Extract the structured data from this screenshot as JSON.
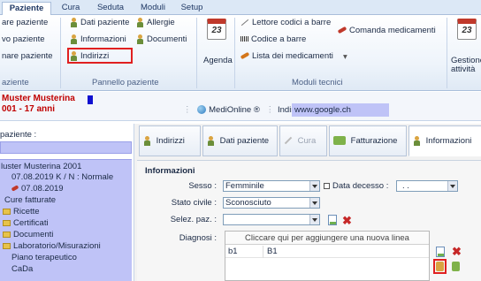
{
  "ribbon_tabs": [
    "Paziente",
    "Cura",
    "Seduta",
    "Moduli",
    "Setup"
  ],
  "ribbon": {
    "left_items": [
      "are paziente",
      "vo paziente",
      "nare paziente"
    ],
    "left_group_label": "aziente",
    "pannello": {
      "items": [
        "Dati paziente",
        "Allergie",
        "Informazioni",
        "Documenti",
        "Indirizzi"
      ],
      "label": "Pannello paziente"
    },
    "agenda": {
      "day": "23",
      "label": "Agenda"
    },
    "tecnici": {
      "items": [
        "Lettore codici a barre",
        "Comanda medicamenti",
        "Codice a barre",
        "Lista dei medicamenti"
      ],
      "label": "Moduli tecnici"
    },
    "gestione": {
      "day": "23",
      "line1": "Gestione",
      "line2": "attività"
    }
  },
  "patient": {
    "name": "Muster Musterina",
    "age": "001 - 17 anni"
  },
  "mediline": {
    "label": "MediOnline ®",
    "indirizzo_label": "Indirizzo",
    "indirizzo_value": "www.google.ch"
  },
  "left": {
    "header": "paziente :",
    "items": [
      "luster Musterina 2001",
      "07.08.2019 K / N : Normale",
      "07.08.2019",
      "Cure fatturate",
      "Ricette",
      "Certificati",
      "Documenti",
      "Laboratorio/Misurazioni",
      "Piano terapeutico",
      "CaDa"
    ]
  },
  "tabs": [
    "Indirizzi",
    "Dati paziente",
    "Cura",
    "Fatturazione",
    "Informazioni"
  ],
  "form": {
    "section": "Informazioni",
    "sesso_label": "Sesso :",
    "sesso_value": "Femminile",
    "decesso_label": "Data decesso :",
    "decesso_value": ". .",
    "stato_label": "Stato civile :",
    "stato_value": "Sconosciuto",
    "selez_label": "Selez. paz. :",
    "diagnosi_label": "Diagnosi :",
    "grid_placeholder": "Cliccare qui per aggiungere una nuova linea",
    "grid_rows": [
      {
        "code": "b1",
        "value": "B1"
      }
    ]
  },
  "colors": {
    "accent_red": "#e02020",
    "patient_red": "#c00000",
    "list_blue": "#bfc3f7"
  }
}
